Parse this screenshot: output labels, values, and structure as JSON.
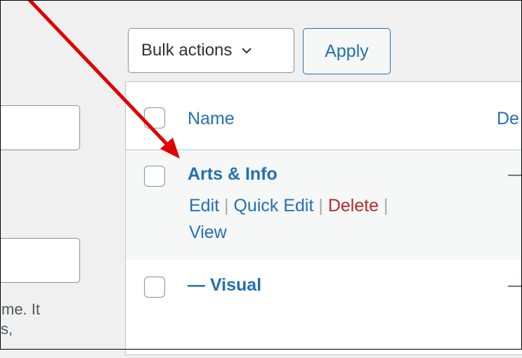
{
  "left_panel": {
    "description_lines": [
      "me. It",
      "s,"
    ]
  },
  "toolbar": {
    "bulk_actions": "Bulk actions",
    "apply": "Apply"
  },
  "table": {
    "columns": [
      "Name",
      "De"
    ],
    "rows": [
      {
        "name": "Arts & Info",
        "actions": [
          "Edit",
          "Quick Edit",
          "Delete",
          "View"
        ],
        "description": "—"
      },
      {
        "name": "— Visual",
        "description": "—"
      }
    ]
  },
  "annotation": {
    "type": "arrow",
    "color": "#e00000"
  },
  "colors": {
    "link": "#2271b1",
    "delete": "#b32d2e",
    "background": "#f0f0f1"
  }
}
